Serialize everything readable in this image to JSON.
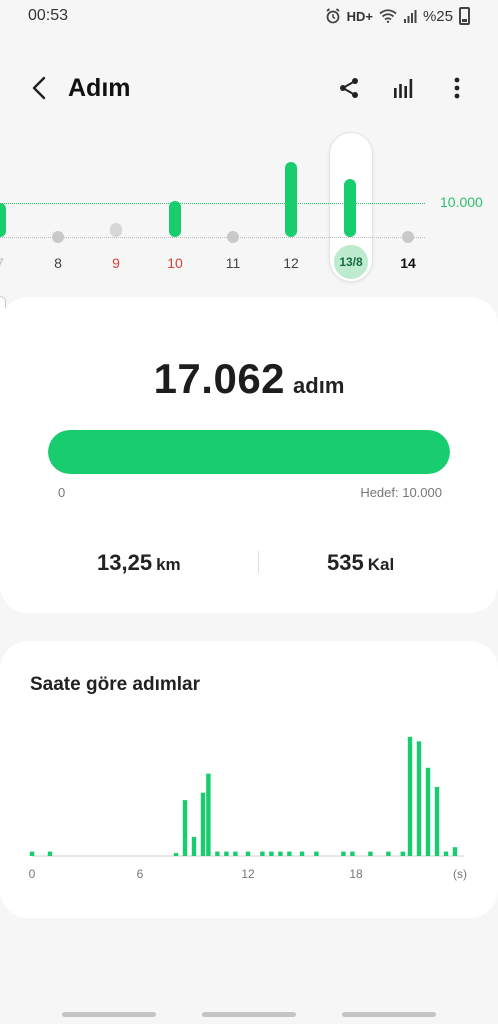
{
  "status_bar": {
    "time": "00:53",
    "network": "HD+",
    "battery": "%25",
    "icons": [
      "alarm-icon",
      "wifi-icon",
      "signal-icon",
      "battery-icon"
    ]
  },
  "app_bar": {
    "title": "Adım",
    "icons": [
      "back-arrow-icon",
      "share-icon",
      "bar-chart-icon",
      "more-vert-icon"
    ]
  },
  "colors": {
    "accent": "#17cd6d",
    "goal_line": "#2cbf6a",
    "weekend_red": "#d9403a",
    "inactive": "#c9c9c9"
  },
  "day_strip": {
    "goal_label": "10.000",
    "days": [
      {
        "label": "7",
        "weekend": false,
        "steps_ratio": 1.0
      },
      {
        "label": "8",
        "weekend": false,
        "steps_ratio": 0.0
      },
      {
        "label": "9",
        "weekend": true,
        "steps_ratio": 0.4
      },
      {
        "label": "10",
        "weekend": true,
        "steps_ratio": 1.05
      },
      {
        "label": "11",
        "weekend": false,
        "steps_ratio": 0.0
      },
      {
        "label": "12",
        "weekend": false,
        "steps_ratio": 2.2
      },
      {
        "label": "13/8",
        "weekend": false,
        "steps_ratio": 1.7,
        "selected": true
      },
      {
        "label": "14",
        "weekend": false,
        "steps_ratio": 0.0
      }
    ]
  },
  "summary": {
    "steps": "17.062",
    "steps_unit": "adım",
    "progress_ratio": 1.0,
    "progress_min": "0",
    "progress_target": "Hedef: 10.000",
    "distance_value": "13,25",
    "distance_unit": "km",
    "calories_value": "535",
    "calories_unit": "Kal"
  },
  "hourly": {
    "title": "Saate göre adımlar",
    "chart_data": {
      "type": "bar",
      "title": "Saate göre adımlar",
      "x_unit": "(s)",
      "x_ticks": [
        "0",
        "6",
        "12",
        "18"
      ],
      "xlim": [
        0,
        24
      ],
      "x": [
        0.0,
        1.0,
        8.0,
        8.5,
        9.0,
        9.5,
        9.8,
        10.3,
        10.8,
        11.3,
        12.0,
        12.8,
        13.3,
        13.8,
        14.3,
        15.0,
        15.8,
        17.3,
        17.8,
        18.8,
        19.8,
        20.6,
        21.0,
        21.5,
        22.0,
        22.5,
        23.0,
        23.5
      ],
      "values": [
        3,
        3,
        2,
        38,
        13,
        43,
        56,
        3,
        3,
        3,
        3,
        3,
        3,
        3,
        3,
        3,
        3,
        3,
        3,
        3,
        3,
        3,
        81,
        78,
        60,
        47,
        3,
        6
      ]
    }
  },
  "nav_hint": [
    "left",
    "center",
    "right"
  ]
}
